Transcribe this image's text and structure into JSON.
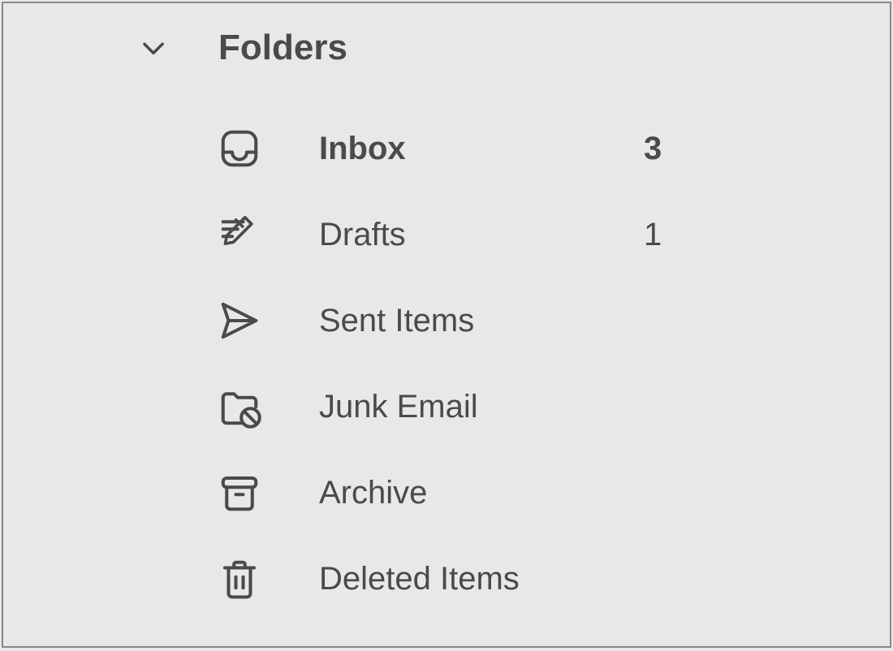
{
  "header": {
    "title": "Folders"
  },
  "folders": [
    {
      "icon": "inbox-icon",
      "label": "Inbox",
      "count": "3",
      "bold": true
    },
    {
      "icon": "drafts-icon",
      "label": "Drafts",
      "count": "1",
      "bold": false
    },
    {
      "icon": "sent-icon",
      "label": "Sent Items",
      "count": "",
      "bold": false
    },
    {
      "icon": "junk-icon",
      "label": "Junk Email",
      "count": "",
      "bold": false
    },
    {
      "icon": "archive-icon",
      "label": "Archive",
      "count": "",
      "bold": false
    },
    {
      "icon": "deleted-icon",
      "label": "Deleted Items",
      "count": "",
      "bold": false
    }
  ]
}
